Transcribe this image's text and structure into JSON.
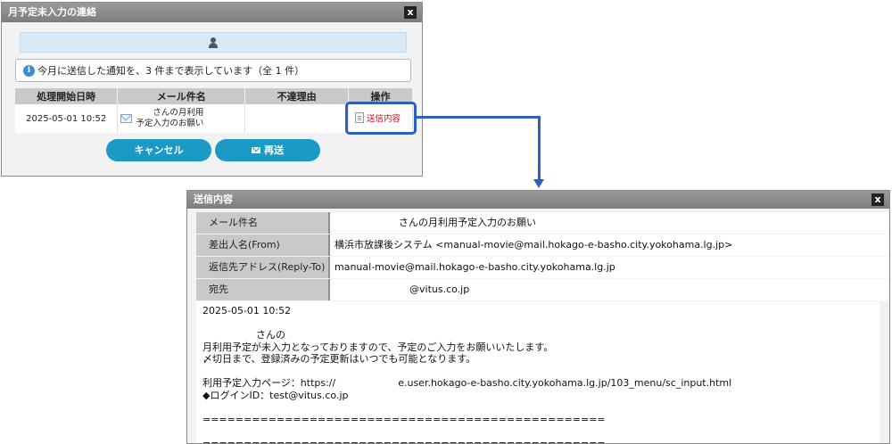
{
  "dialog1": {
    "title": "月予定未入力の連絡",
    "close": "x",
    "info_text": "今月に送信した通知を、3 件まで表示しています（全 1 件）",
    "columns": [
      "処理開始日時",
      "メール件名",
      "不達理由",
      "操作"
    ],
    "rows": [
      {
        "date": "2025-05-01 10:52",
        "subject_line1": "さんの月利用",
        "subject_line2": "予定入力のお願い",
        "reason": "",
        "action": "送信内容"
      }
    ],
    "cancel_label": "キャンセル",
    "resend_label": "再送"
  },
  "dialog2": {
    "title": "送信内容",
    "close": "x",
    "fields": [
      {
        "label": "メール件名",
        "value": "さんの月利用予定入力のお願い"
      },
      {
        "label": "差出人名(From)",
        "value": "横浜市放課後システム <manual-movie@mail.hokago-e-basho.city.yokohama.lg.jp>"
      },
      {
        "label": "返信先アドレス(Reply-To)",
        "value": "manual-movie@mail.hokago-e-basho.city.yokohama.lg.jp"
      },
      {
        "label": "宛先",
        "value": "@vitus.co.jp"
      }
    ],
    "body_lines": [
      "2025-05-01 10:52",
      "",
      "さんの",
      "月利用予定が未入力となっておりますので、予定のご入力をお願いいたします。",
      "〆切日まで、登録済みの予定更新はいつでも可能となります。",
      "",
      "利用予定入力ページ：https://",
      "◆ログインID：test@vitus.co.jp",
      "",
      "=================================================",
      "",
      "================================================="
    ],
    "url_tail": "e.user.hokago-e-basho.city.yokohama.lg.jp/103_menu/sc_input.html"
  }
}
